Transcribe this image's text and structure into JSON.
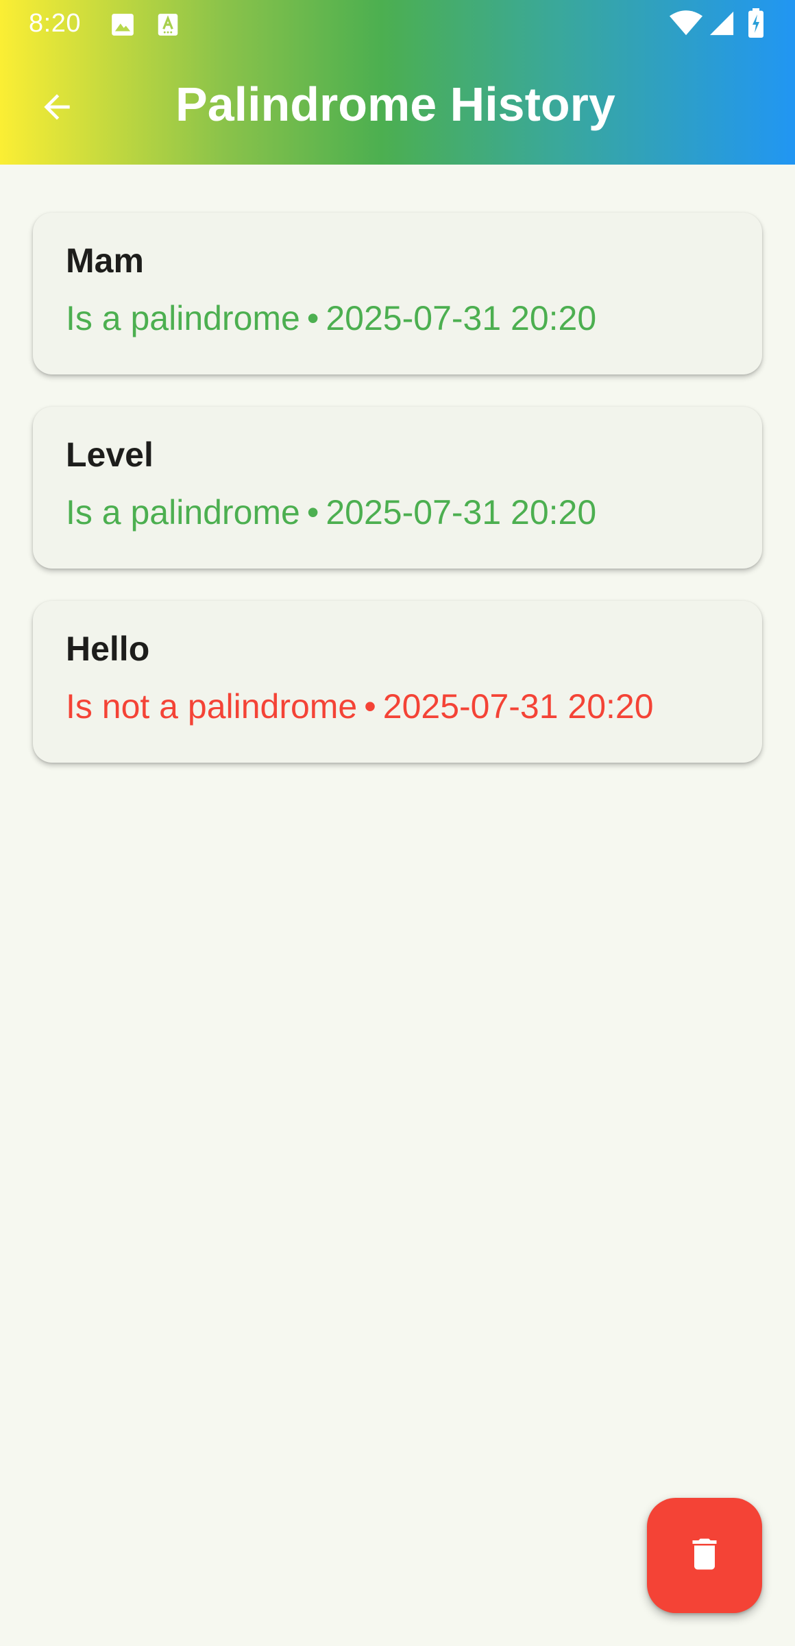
{
  "status_bar": {
    "time": "8:20",
    "icons": [
      "image-icon",
      "text-format-icon",
      "wifi-icon",
      "signal-icon",
      "battery-charging-icon"
    ]
  },
  "app_bar": {
    "title": "Palindrome History",
    "back_icon": "arrow-back-icon",
    "gradient": [
      "#fbee34",
      "#8bc34a",
      "#4caf50",
      "#3aa89a",
      "#2196f3"
    ]
  },
  "history": [
    {
      "word": "Mam",
      "status": "Is a palindrome",
      "separator": "•",
      "timestamp": "2025-07-31 20:20",
      "is_palindrome": true
    },
    {
      "word": "Level",
      "status": "Is a palindrome",
      "separator": "•",
      "timestamp": "2025-07-31 20:20",
      "is_palindrome": true
    },
    {
      "word": "Hello",
      "status": "Is not a palindrome",
      "separator": "•",
      "timestamp": "2025-07-31 20:20",
      "is_palindrome": false
    }
  ],
  "colors": {
    "palindrome": "#4caf50",
    "not_palindrome": "#f44336",
    "background": "#f6f8f0",
    "card": "#f2f4ec",
    "fab": "#f44336"
  },
  "fab": {
    "icon": "trash-icon",
    "action": "clear-history"
  }
}
